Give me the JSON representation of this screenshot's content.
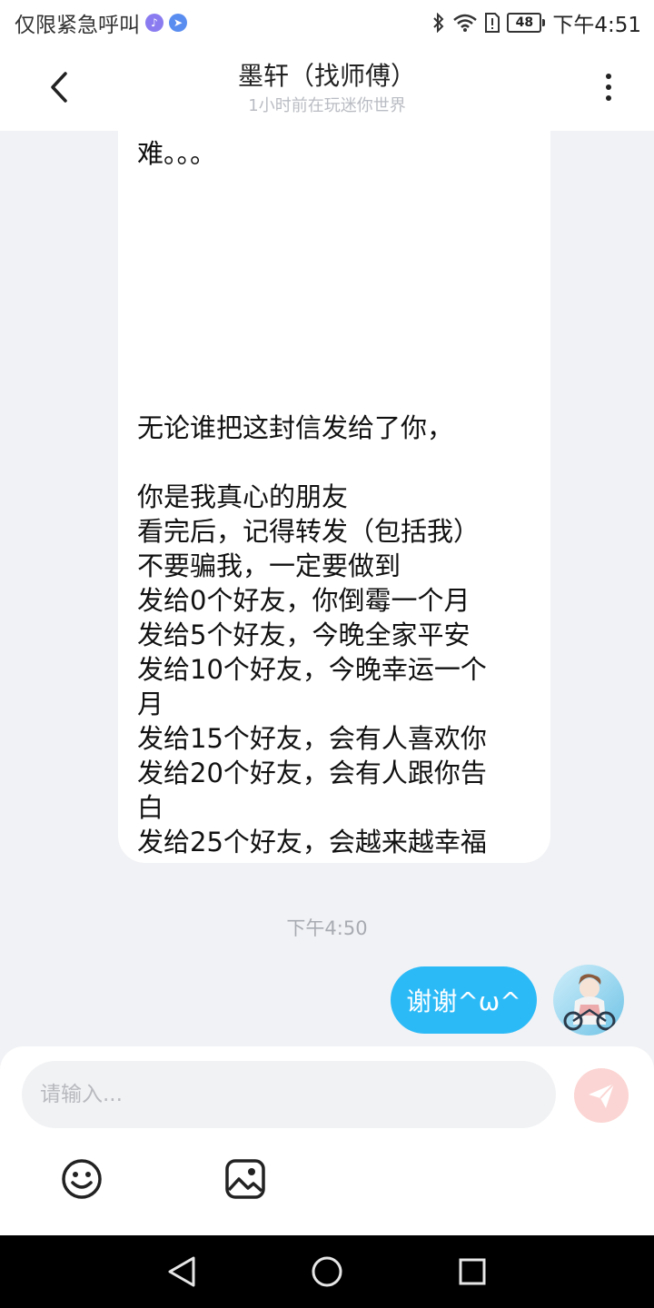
{
  "status_bar": {
    "carrier_text": "仅限紧急呼叫",
    "battery": "48",
    "time": "下午4:51",
    "icons": [
      "music-icon",
      "navigation-icon",
      "bluetooth-icon",
      "wifi-icon",
      "sim-alert-icon",
      "battery-icon"
    ]
  },
  "header": {
    "title": "墨轩（找师傅）",
    "subtitle": "1小时前在玩迷你世界",
    "back_icon": "chevron-left-icon",
    "more_icon": "more-vertical-icon"
  },
  "messages": {
    "incoming_lines": [
      "难。。。",
      " 无论谁把这封信发给了你，",
      "你是我真心的朋友",
      "看完后，记得转发（包括我）",
      "不要骗我，一定要做到",
      "发给0个好友，你倒霉一个月",
      "发给5个好友，今晚全家平安",
      "发给10个好友，今晚幸运一个",
      "月",
      "发给15个好友，会有人喜欢你",
      "发给20个好友，会有人跟你告",
      "白",
      "发给25个好友，会越来越幸福"
    ],
    "timestamp": "下午4:50",
    "outgoing_text": "谢谢^ω^"
  },
  "input": {
    "placeholder": "请输入...",
    "send_icon": "paper-plane-icon",
    "emoji_icon": "smiley-icon",
    "image_icon": "image-icon"
  },
  "nav_bar": {
    "icons": [
      "back-triangle-icon",
      "home-circle-icon",
      "recents-square-icon"
    ]
  },
  "colors": {
    "outgoing_bubble": "#2cbaf7",
    "chat_background": "#f1f2f5",
    "send_button": "#fbd5d3"
  }
}
